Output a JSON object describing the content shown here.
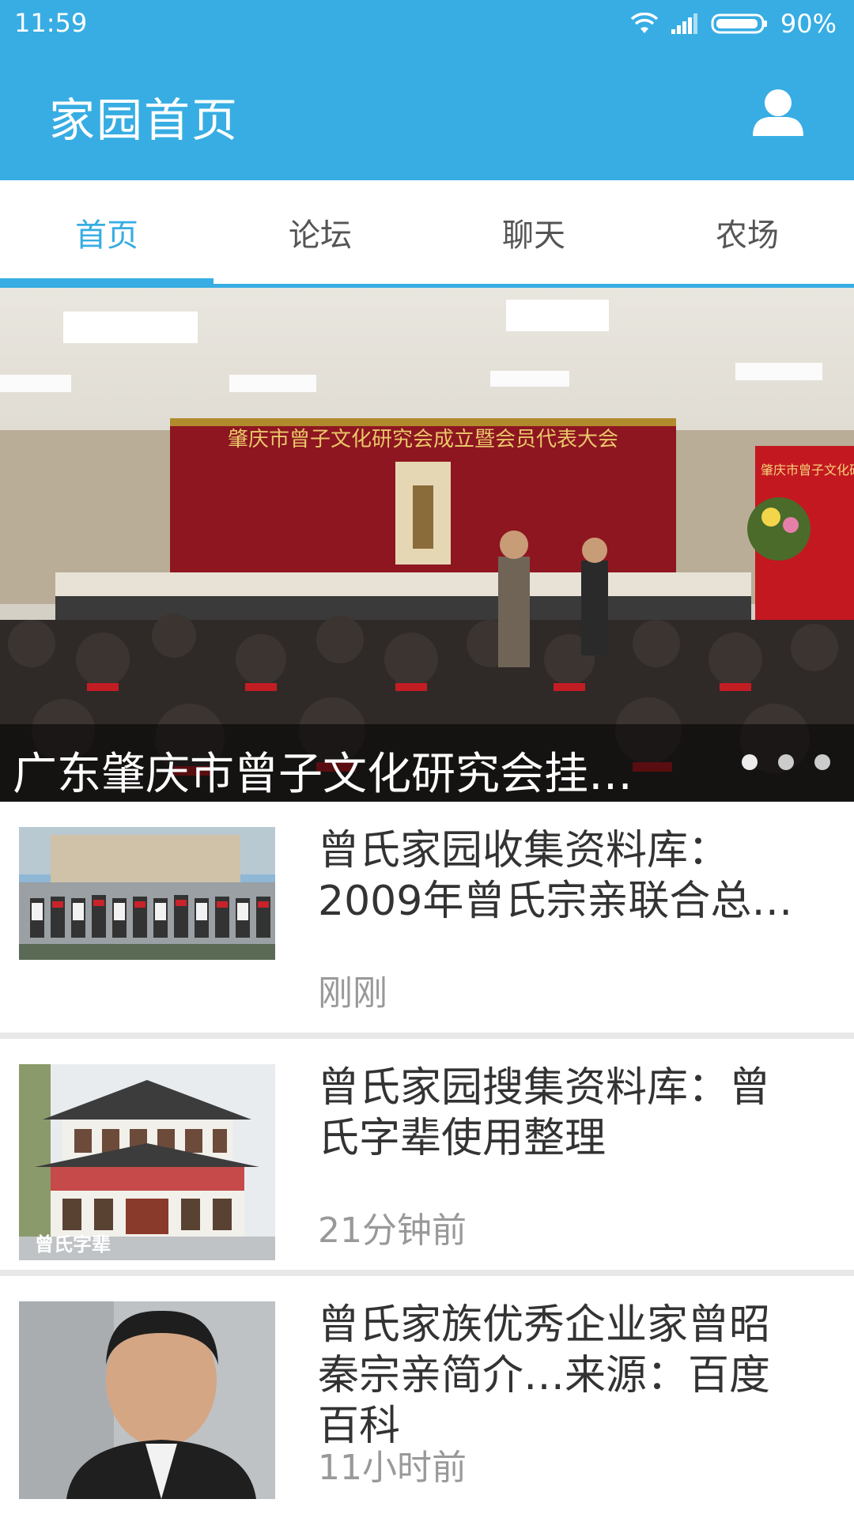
{
  "status_bar": {
    "time": "11:59",
    "battery": "90%"
  },
  "app_bar": {
    "title": "家园首页",
    "profile_icon": "person-icon"
  },
  "tabs": [
    {
      "label": "首页",
      "active": true
    },
    {
      "label": "论坛",
      "active": false
    },
    {
      "label": "聊天",
      "active": false
    },
    {
      "label": "农场",
      "active": false
    }
  ],
  "banner": {
    "caption": "广东肇庆市曾子文化研究会挂…",
    "banner_text": "肇庆市曾子文化研究会成立暨会员代表大会",
    "side_banner_text": "肇庆市曾子文化研",
    "pages": 3,
    "current_page": 1
  },
  "news": [
    {
      "title": "曾氏家园收集资料库：2009年曾氏宗亲联合总…",
      "time": "刚刚"
    },
    {
      "title": "曾氏家园搜集资料库：曾氏字辈使用整理",
      "time": "21分钟前",
      "thumb_label": "曾氏字辈"
    },
    {
      "title": "曾氏家族优秀企业家曾昭秦宗亲简介…来源：百度百科",
      "time": "11小时前"
    }
  ],
  "colors": {
    "primary": "#37ade3"
  }
}
